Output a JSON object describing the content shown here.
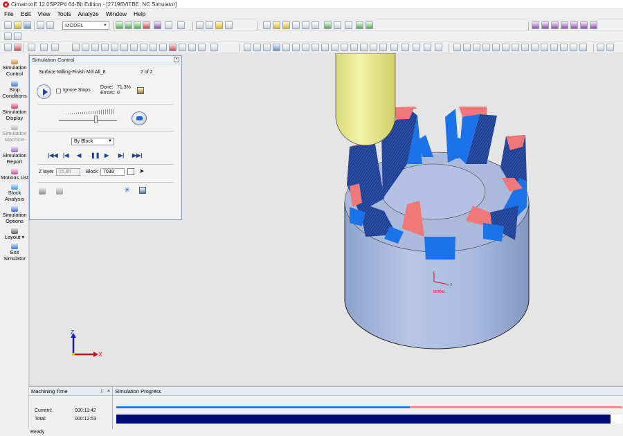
{
  "window": {
    "title": "CimatronE 12.0SP2P4  64-Bit Edition - [27196VITBE: NC Simulator]"
  },
  "menu": [
    "File",
    "Edit",
    "View",
    "Tools",
    "Analyze",
    "Window",
    "Help"
  ],
  "toolbar": {
    "model_combo": "MODEL"
  },
  "left_toolbar": {
    "items": [
      {
        "label1": "Simulation",
        "label2": "Control",
        "icon": "simulation-control-icon",
        "enabled": true
      },
      {
        "label1": "Stop",
        "label2": "Conditions",
        "icon": "stop-conditions-icon",
        "enabled": true
      },
      {
        "label1": "Simulation",
        "label2": "Display",
        "icon": "simulation-display-icon",
        "enabled": true
      },
      {
        "label1": "Simulation",
        "label2": "Machine",
        "icon": "simulation-machine-icon",
        "enabled": false
      },
      {
        "label1": "Simulation",
        "label2": "Report",
        "icon": "simulation-report-icon",
        "enabled": true
      },
      {
        "label1": "Motions List",
        "label2": "",
        "icon": "motions-list-icon",
        "enabled": true
      },
      {
        "label1": "Stock",
        "label2": "Analysis",
        "icon": "stock-analysis-icon",
        "enabled": true
      },
      {
        "label1": "Simulation",
        "label2": "Options",
        "icon": "simulation-options-icon",
        "enabled": true
      },
      {
        "label1": "Layout",
        "label2": "",
        "icon": "layout-icon",
        "enabled": true
      },
      {
        "label1": "Exit",
        "label2": "Simulator",
        "icon": "exit-simulator-icon",
        "enabled": true
      }
    ]
  },
  "sim_panel": {
    "title": "Simulation Control",
    "procedure": "Surface Milling-Finish Mill All_8",
    "procedure_index": "2 of 2",
    "ignore_stops_label": "Ignore Stops",
    "done_label": "Done:",
    "done_value": "71,3%",
    "errors_label": "Errors:",
    "errors_value": "0",
    "step_mode": "By Block",
    "zlayer_label": "Z layer",
    "zlayer_value": "15,85",
    "block_label": "Block",
    "block_value": "7039"
  },
  "viewport": {
    "model_label": "MODEL",
    "axis_x": "X",
    "axis_y": "Y",
    "axis_z": "Z"
  },
  "bottom": {
    "machining_time_title": "Machining Time",
    "current_label": "Current:",
    "current_value": "000:11:42",
    "total_label": "Total:",
    "total_value": "000:12:53",
    "progress_title": "Simulation Progress",
    "thin_progress": 0.58,
    "thick_progress": 0.977
  },
  "status": {
    "text": "Ready"
  },
  "colors": {
    "stock": "#a8bce2",
    "cut_blue": "#1a73e8",
    "cut_pink": "#f07878",
    "tool": "#e6e68a",
    "progress_dark": "#000a78"
  }
}
